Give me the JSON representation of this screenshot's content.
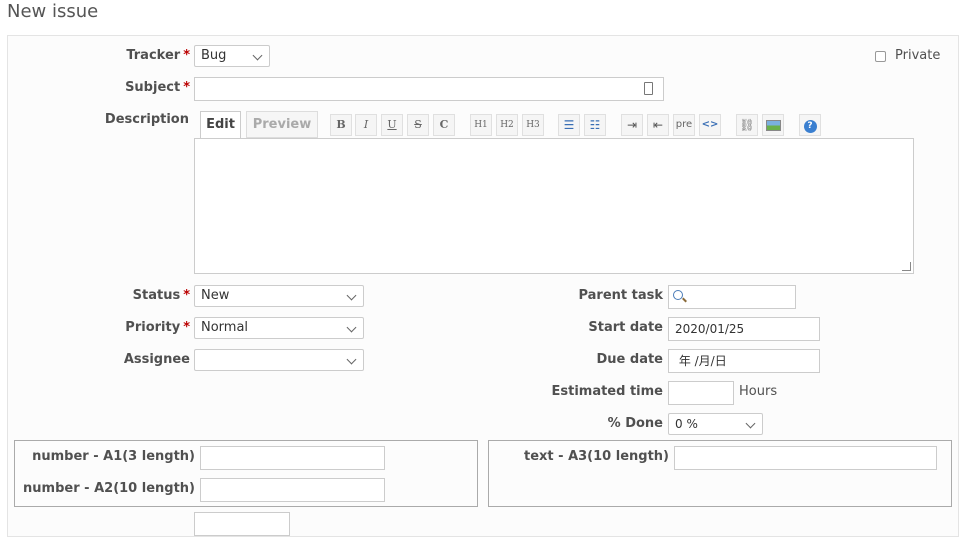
{
  "page": {
    "title": "New issue"
  },
  "form": {
    "tracker": {
      "label": "Tracker",
      "required": "*",
      "value": "Bug"
    },
    "private": {
      "label": "Private"
    },
    "subject": {
      "label": "Subject",
      "required": "*"
    },
    "description": {
      "label": "Description"
    },
    "editor": {
      "tabs": [
        "Edit",
        "Preview"
      ],
      "toolbar": [
        "B",
        "I",
        "U",
        "S",
        "C",
        "H1",
        "H2",
        "H3",
        "ul",
        "ol",
        "indent",
        "outdent",
        "pre",
        "<>",
        "link",
        "image",
        "?"
      ]
    },
    "status": {
      "label": "Status",
      "required": "*",
      "value": "New"
    },
    "priority": {
      "label": "Priority",
      "required": "*",
      "value": "Normal"
    },
    "assignee": {
      "label": "Assignee",
      "value": ""
    },
    "parent_task": {
      "label": "Parent task"
    },
    "start_date": {
      "label": "Start date",
      "value": "2020/01/25"
    },
    "due_date": {
      "label": "Due date",
      "value": " 年 /月/日"
    },
    "estimated_time": {
      "label": "Estimated time",
      "unit": "Hours"
    },
    "done": {
      "label": "% Done",
      "value": "0 %"
    }
  },
  "custom_fields": {
    "a1": {
      "label": "number - A1(3 length)"
    },
    "a2": {
      "label": "number - A2(10 length)"
    },
    "a3": {
      "label": "text - A3(10 length)"
    }
  }
}
